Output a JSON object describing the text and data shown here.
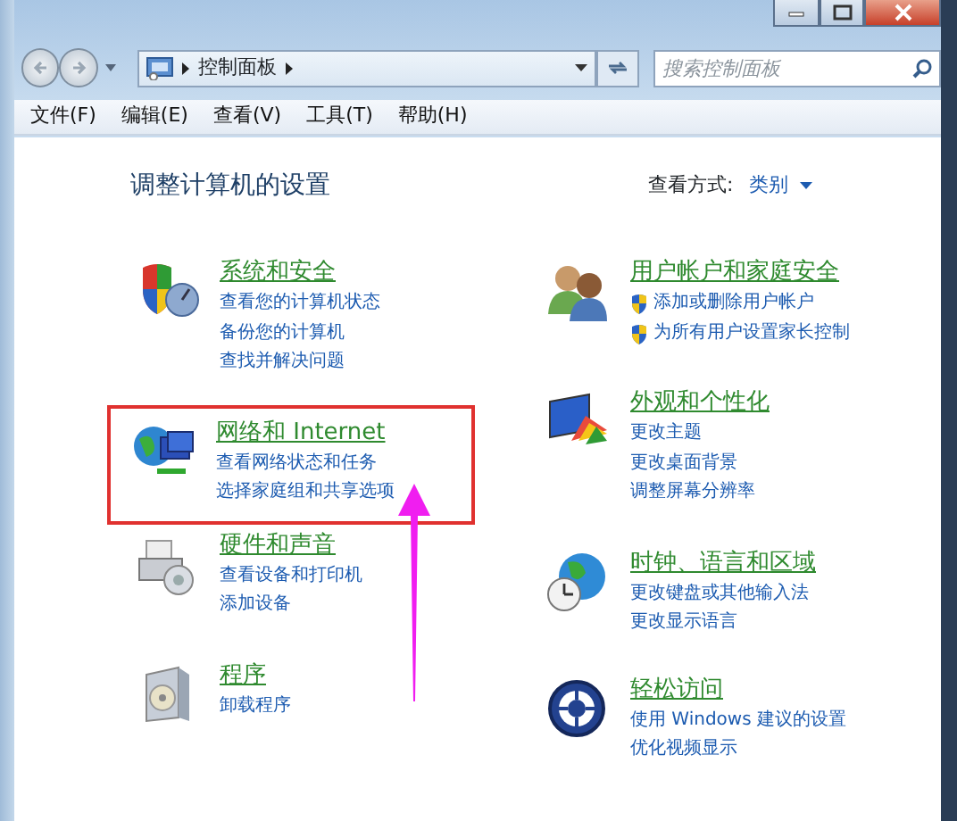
{
  "address_bar": {
    "path": [
      "控制面板"
    ]
  },
  "search": {
    "placeholder": "搜索控制面板"
  },
  "menu": [
    "文件(F)",
    "编辑(E)",
    "查看(V)",
    "工具(T)",
    "帮助(H)"
  ],
  "heading": "调整计算机的设置",
  "view_by": {
    "label": "查看方式:",
    "value": "类别"
  },
  "left_column": [
    {
      "kind": "security",
      "title": "系统和安全",
      "highlighted": false,
      "links": [
        {
          "text": "查看您的计算机状态",
          "shield": false
        },
        {
          "text": "备份您的计算机",
          "shield": false
        },
        {
          "text": "查找并解决问题",
          "shield": false
        }
      ]
    },
    {
      "kind": "network",
      "title": "网络和 Internet",
      "highlighted": true,
      "links": [
        {
          "text": "查看网络状态和任务",
          "shield": false
        },
        {
          "text": "选择家庭组和共享选项",
          "shield": false
        }
      ]
    },
    {
      "kind": "hardware",
      "title": "硬件和声音",
      "highlighted": false,
      "links": [
        {
          "text": "查看设备和打印机",
          "shield": false
        },
        {
          "text": "添加设备",
          "shield": false
        }
      ]
    },
    {
      "kind": "programs",
      "title": "程序",
      "highlighted": false,
      "links": [
        {
          "text": "卸载程序",
          "shield": false
        }
      ]
    }
  ],
  "right_column": [
    {
      "kind": "users",
      "title": "用户帐户和家庭安全",
      "highlighted": false,
      "links": [
        {
          "text": "添加或删除用户帐户",
          "shield": true
        },
        {
          "text": "为所有用户设置家长控制",
          "shield": true
        }
      ]
    },
    {
      "kind": "appearance",
      "title": "外观和个性化",
      "highlighted": false,
      "links": [
        {
          "text": "更改主题",
          "shield": false
        },
        {
          "text": "更改桌面背景",
          "shield": false
        },
        {
          "text": "调整屏幕分辨率",
          "shield": false
        }
      ]
    },
    {
      "kind": "clock",
      "title": "时钟、语言和区域",
      "highlighted": false,
      "links": [
        {
          "text": "更改键盘或其他输入法",
          "shield": false
        },
        {
          "text": "更改显示语言",
          "shield": false
        }
      ]
    },
    {
      "kind": "access",
      "title": "轻松访问",
      "highlighted": false,
      "links": [
        {
          "text": "使用 Windows 建议的设置",
          "shield": false
        },
        {
          "text": "优化视频显示",
          "shield": false
        }
      ]
    }
  ],
  "annotation": {
    "kind": "arrow"
  }
}
